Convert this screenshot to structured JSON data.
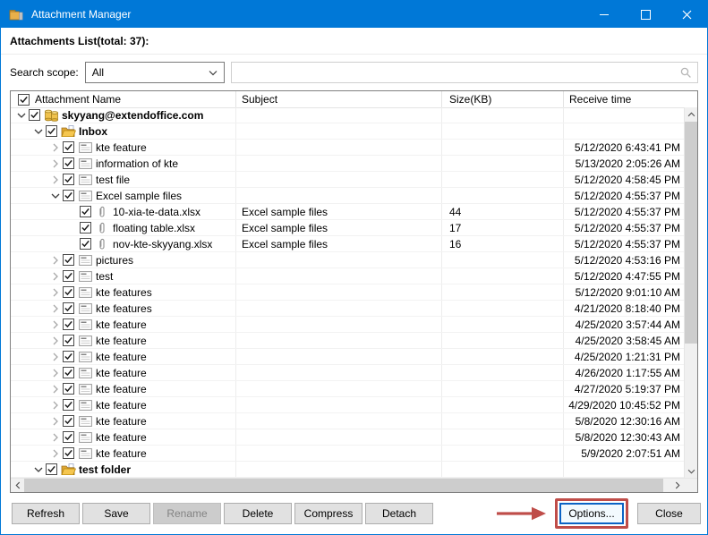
{
  "window": {
    "title": "Attachment Manager"
  },
  "header": {
    "attachments_label": "Attachments List(total: 37):"
  },
  "search": {
    "label": "Search scope:",
    "scope_value": "All",
    "input_value": ""
  },
  "colors": {
    "titlebar": "#0078d7",
    "annotation_red": "#bf4d49",
    "folder_gold": "#f0c24c"
  },
  "list": {
    "columns": [
      "Attachment Name",
      "Subject",
      "Size(KB)",
      "Receive time"
    ],
    "select_all_checked": true,
    "rows": [
      {
        "level": 0,
        "chevron": "down",
        "icon": "account",
        "checked": true,
        "bold": true,
        "name": "skyyang@extendoffice.com"
      },
      {
        "level": 1,
        "chevron": "down",
        "icon": "folder-open",
        "checked": true,
        "bold": true,
        "name": "Inbox"
      },
      {
        "level": 2,
        "chevron": "right",
        "icon": "message",
        "checked": true,
        "name": "kte feature",
        "time": "5/12/2020 6:43:41 PM"
      },
      {
        "level": 2,
        "chevron": "right",
        "icon": "message",
        "checked": true,
        "name": "information of kte",
        "time": "5/13/2020 2:05:26 AM"
      },
      {
        "level": 2,
        "chevron": "right",
        "icon": "message",
        "checked": true,
        "name": "test file",
        "time": "5/12/2020 4:58:45 PM"
      },
      {
        "level": 2,
        "chevron": "down",
        "icon": "message",
        "checked": true,
        "name": "Excel sample files",
        "time": "5/12/2020 4:55:37 PM"
      },
      {
        "level": 3,
        "chevron": "none",
        "icon": "attachment",
        "checked": true,
        "name": "10-xia-te-data.xlsx",
        "subject": "Excel sample files",
        "size": "44",
        "time": "5/12/2020 4:55:37 PM"
      },
      {
        "level": 3,
        "chevron": "none",
        "icon": "attachment",
        "checked": true,
        "name": "floating table.xlsx",
        "subject": "Excel sample files",
        "size": "17",
        "time": "5/12/2020 4:55:37 PM"
      },
      {
        "level": 3,
        "chevron": "none",
        "icon": "attachment",
        "checked": true,
        "name": "nov-kte-skyyang.xlsx",
        "subject": "Excel sample files",
        "size": "16",
        "time": "5/12/2020 4:55:37 PM"
      },
      {
        "level": 2,
        "chevron": "right",
        "icon": "message",
        "checked": true,
        "name": "pictures",
        "time": "5/12/2020 4:53:16 PM"
      },
      {
        "level": 2,
        "chevron": "right",
        "icon": "message",
        "checked": true,
        "name": "test",
        "time": "5/12/2020 4:47:55 PM"
      },
      {
        "level": 2,
        "chevron": "right",
        "icon": "message",
        "checked": true,
        "name": "kte features",
        "time": "5/12/2020 9:01:10 AM"
      },
      {
        "level": 2,
        "chevron": "right",
        "icon": "message",
        "checked": true,
        "name": "kte features",
        "time": "4/21/2020 8:18:40 PM"
      },
      {
        "level": 2,
        "chevron": "right",
        "icon": "message",
        "checked": true,
        "name": "kte feature",
        "time": "4/25/2020 3:57:44 AM"
      },
      {
        "level": 2,
        "chevron": "right",
        "icon": "message",
        "checked": true,
        "name": "kte feature",
        "time": "4/25/2020 3:58:45 AM"
      },
      {
        "level": 2,
        "chevron": "right",
        "icon": "message",
        "checked": true,
        "name": "kte feature",
        "time": "4/25/2020 1:21:31 PM"
      },
      {
        "level": 2,
        "chevron": "right",
        "icon": "message",
        "checked": true,
        "name": "kte feature",
        "time": "4/26/2020 1:17:55 AM"
      },
      {
        "level": 2,
        "chevron": "right",
        "icon": "message",
        "checked": true,
        "name": "kte feature",
        "time": "4/27/2020 5:19:37 PM"
      },
      {
        "level": 2,
        "chevron": "right",
        "icon": "message",
        "checked": true,
        "name": "kte feature",
        "time": "4/29/2020 10:45:52 PM"
      },
      {
        "level": 2,
        "chevron": "right",
        "icon": "message",
        "checked": true,
        "name": "kte feature",
        "time": "5/8/2020 12:30:16 AM"
      },
      {
        "level": 2,
        "chevron": "right",
        "icon": "message",
        "checked": true,
        "name": "kte feature",
        "time": "5/8/2020 12:30:43 AM"
      },
      {
        "level": 2,
        "chevron": "right",
        "icon": "message",
        "checked": true,
        "name": "kte feature",
        "time": "5/9/2020 2:07:51 AM"
      },
      {
        "level": 1,
        "chevron": "down",
        "icon": "folder-open",
        "checked": true,
        "bold": true,
        "name": "test folder"
      }
    ]
  },
  "buttons": {
    "refresh": "Refresh",
    "save": "Save",
    "rename": "Rename",
    "rename_disabled": true,
    "delete": "Delete",
    "compress": "Compress",
    "detach": "Detach",
    "options": "Options...",
    "options_highlighted": true,
    "close": "Close"
  }
}
